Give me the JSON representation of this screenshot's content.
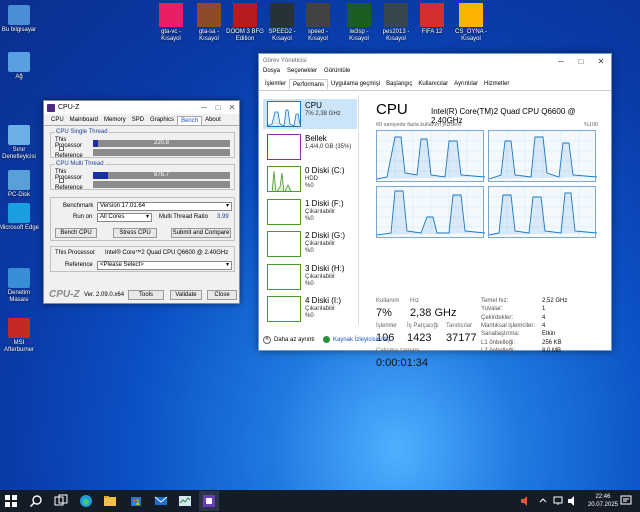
{
  "desktop_left": [
    "Bu bilgisayar",
    "Ağ",
    "Sınır Denetleyicisi",
    "PC-Disk",
    "Microsoft Edge",
    "Denetim Masası",
    "MSI Afterburner"
  ],
  "desktop_top": [
    {
      "label": "gta-vc - Kısayol",
      "color": "#e91e63"
    },
    {
      "label": "gta-sa - Kısayol",
      "color": "#8d4b2a"
    },
    {
      "label": "DOOM 3 BFG Edition",
      "color": "#b71c1c"
    },
    {
      "label": "SPEED2 - Kısayol",
      "color": "#263238"
    },
    {
      "label": "speed - Kısayol",
      "color": "#424242"
    },
    {
      "label": "iw3sp - Kısayol",
      "color": "#1b5e20"
    },
    {
      "label": "pes2013 - Kısayol",
      "color": "#37474f"
    },
    {
      "label": "FIFA 12",
      "color": "#d32f2f"
    },
    {
      "label": "CS_OYNA - Kısayol",
      "color": "#ffb300"
    }
  ],
  "cpuz": {
    "title": "CPU-Z",
    "tabs": [
      "CPU",
      "Mainboard",
      "Memory",
      "SPD",
      "Graphics",
      "Bench",
      "About"
    ],
    "single_title": "CPU Single Thread",
    "multi_title": "CPU Multi Thread",
    "this_processor": "This Processor",
    "reference": "Reference",
    "single_value": "220.8",
    "single_fill": 0.04,
    "multi_value": "878.7",
    "multi_fill": 0.11,
    "benchmark_label": "Benchmark",
    "benchmark_value": "Version 17.01.64",
    "runon_label": "Run on",
    "runon_value": "All Cores",
    "ratio_label": "Multi Thread Ratio",
    "ratio_value": "3.99",
    "btn_bench": "Bench CPU",
    "btn_stress": "Stress CPU",
    "btn_submit": "Submit and Compare",
    "proc_label": "This Processor",
    "proc_value": "Intel® Core™2 Quad CPU    Q6600 @ 2.40GHz",
    "ref_label": "Reference",
    "ref_value": "<Please Select>",
    "brand": "CPU-Z",
    "version": "Ver. 2.09.0.x64",
    "btn_tools": "Tools",
    "btn_validate": "Validate",
    "btn_close": "Close"
  },
  "taskman": {
    "title": "Görev Yöneticisi",
    "menu": [
      "Dosya",
      "Seçenekler",
      "Görüntüle"
    ],
    "tabs": [
      "İşlemler",
      "Performans",
      "Uygulama geçmişi",
      "Başlangıç",
      "Kullanıcılar",
      "Ayrıntılar",
      "Hizmetler"
    ],
    "side": [
      {
        "name": "CPU",
        "s1": "7% 2,38 GHz",
        "s2": ""
      },
      {
        "name": "Bellek",
        "s1": "1,4/4,0 GB (35%)",
        "s2": ""
      },
      {
        "name": "0 Diski (C:)",
        "s1": "HDD",
        "s2": "%0"
      },
      {
        "name": "1 Diski (F:)",
        "s1": "Çıkarılabilir",
        "s2": "%0"
      },
      {
        "name": "2 Diski (G:)",
        "s1": "Çıkarılabilir",
        "s2": "%0"
      },
      {
        "name": "3 Diski (H:)",
        "s1": "Çıkarılabilir",
        "s2": "%0"
      },
      {
        "name": "4 Diski (I:)",
        "s1": "Çıkarılabilir",
        "s2": "%0"
      }
    ],
    "cpu_title": "CPU",
    "cpu_name": "Intel(R) Core(TM)2 Quad CPU Q6600 @ 2.40GHz",
    "graph_caption": "60 saniyede fazla kullanım yüzdesi",
    "graph_max": "%100",
    "kullanim_lbl": "Kullanım",
    "kullanim_val": "7%",
    "hiz_lbl": "Hız",
    "hiz_val": "2,38 GHz",
    "islemler_lbl": "İşlemler",
    "islemler_val": "106",
    "parcacigi_lbl": "İş Parçacığı",
    "parcacigi_val": "1423",
    "tanitici_lbl": "Tanıtıcılar",
    "tanitici_val": "37177",
    "sure_lbl": "Çalışma zamanı",
    "sure_val": "0:00:01:34",
    "kv": [
      [
        "Temel hız:",
        "2,52 GHz"
      ],
      [
        "Yuvalar:",
        "1"
      ],
      [
        "Çekirdekler:",
        "4"
      ],
      [
        "Mantıksal işlemciler:",
        "4"
      ],
      [
        "Sanallaştırma:",
        "Etkin"
      ],
      [
        "L1 önbelleği:",
        "256 KB"
      ],
      [
        "L2 önbelleği:",
        "8,0 MB"
      ]
    ],
    "less": "Daha az ayrıntı",
    "monitor": "Kaynak İzleyicisini Aç"
  },
  "taskbar": {
    "time": "22:46",
    "date": "20.07.2025"
  }
}
